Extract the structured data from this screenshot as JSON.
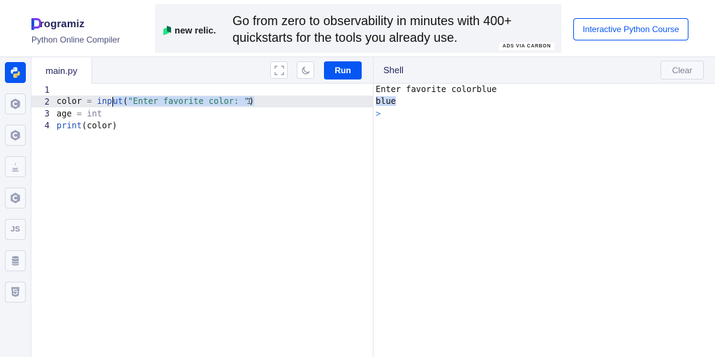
{
  "header": {
    "brand_name": "rogramiz",
    "brand_subtitle": "Python Online Compiler",
    "ad_brand": "new relic.",
    "ad_text": "Go from zero to observability in minutes with 400+ quickstarts for the tools you already use.",
    "ad_via": "ADS VIA CARBON",
    "course_button": "Interactive Python Course"
  },
  "sidebar": {
    "items": [
      {
        "name": "python",
        "icon": "python-icon",
        "label": "",
        "active": true
      },
      {
        "name": "c",
        "icon": "c-icon",
        "label": "C"
      },
      {
        "name": "cpp",
        "icon": "cpp-icon",
        "label": "C"
      },
      {
        "name": "java",
        "icon": "java-icon",
        "label": ""
      },
      {
        "name": "csharp",
        "icon": "csharp-icon",
        "label": "C"
      },
      {
        "name": "javascript",
        "icon": "js-icon",
        "label": "JS"
      },
      {
        "name": "sql",
        "icon": "database-icon",
        "label": ""
      },
      {
        "name": "html",
        "icon": "html5-icon",
        "label": "5"
      }
    ]
  },
  "editor": {
    "file_tab": "main.py",
    "run_label": "Run",
    "lines": [
      {
        "number": "1",
        "text": ""
      },
      {
        "number": "2",
        "text": "color = input(\"Enter favorite color: \")"
      },
      {
        "number": "3",
        "text": "age = int"
      },
      {
        "number": "4",
        "text": "print(color)"
      }
    ],
    "line2": {
      "p1": "color ",
      "op": "=",
      "p2": " inp",
      "p3": "ut",
      "p4": "(",
      "str": "\"Enter favorite color: \"",
      "p5": ")"
    },
    "line3": {
      "p1": "age ",
      "op": "=",
      "p2": " int"
    },
    "line4": {
      "fn": "print",
      "p1": "(color)"
    }
  },
  "shell": {
    "title": "Shell",
    "clear_label": "Clear",
    "lines": [
      "Enter favorite colorblue",
      "blue",
      ">"
    ]
  },
  "colors": {
    "accent": "#0556f3",
    "sidebar_bg": "#f3f5f9",
    "selection": "#c8d9f5"
  }
}
